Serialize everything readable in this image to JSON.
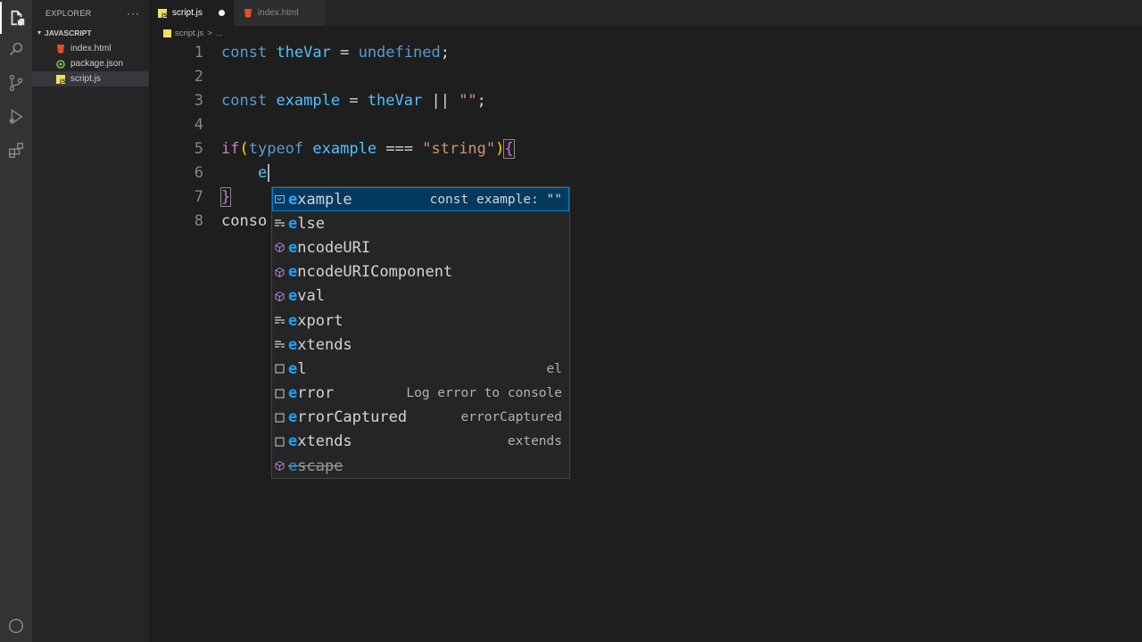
{
  "sidebar": {
    "title": "EXPLORER",
    "more": "···",
    "section": "JAVASCRIPT",
    "files": [
      {
        "name": "index.html",
        "icon": "html-file-icon",
        "color": "#e44d26"
      },
      {
        "name": "package.json",
        "icon": "npm-file-icon",
        "color": "#8bc34a"
      },
      {
        "name": "script.js",
        "icon": "js-file-icon",
        "color": "#f1e05a"
      }
    ]
  },
  "tabs": [
    {
      "label": "script.js",
      "active": true,
      "dirty": true
    },
    {
      "label": "index.html",
      "active": false
    }
  ],
  "breadcrumb": {
    "file": "script.js",
    "sep": ">",
    "rest": "..."
  },
  "editor": {
    "line_numbers": [
      "1",
      "2",
      "3",
      "4",
      "5",
      "6",
      "7",
      "8"
    ],
    "lines": {
      "l1": {
        "kw": "const",
        "var": "theVar",
        "eq": " = ",
        "val": "undefined",
        "end": ";"
      },
      "l3": {
        "kw": "const",
        "var": "example",
        "eq": " = ",
        "var2": "theVar",
        "op": " || ",
        "str": "\"\"",
        "end": ";"
      },
      "l5": {
        "kw": "if",
        "open": "(",
        "kw2": "typeof",
        "var": "example",
        "op": " === ",
        "str": "\"string\"",
        "close": ")",
        "brace": "{"
      },
      "l6": {
        "indent": "    ",
        "typed": "e"
      },
      "l7": {
        "brace": "}"
      },
      "l8": {
        "text": "conso"
      }
    }
  },
  "suggest": {
    "items": [
      {
        "hl": "e",
        "rest": "xample",
        "detail": "const example: \"\"",
        "icon": "variable-icon",
        "focused": true
      },
      {
        "hl": "e",
        "rest": "lse",
        "detail": "",
        "icon": "keyword-icon"
      },
      {
        "hl": "e",
        "rest": "ncodeURI",
        "detail": "",
        "icon": "module-icon"
      },
      {
        "hl": "e",
        "rest": "ncodeURIComponent",
        "detail": "",
        "icon": "module-icon"
      },
      {
        "hl": "e",
        "rest": "val",
        "detail": "",
        "icon": "module-icon"
      },
      {
        "hl": "e",
        "rest": "xport",
        "detail": "",
        "icon": "keyword-icon"
      },
      {
        "hl": "e",
        "rest": "xtends",
        "detail": "",
        "icon": "keyword-icon"
      },
      {
        "hl": "e",
        "rest": "l",
        "detail": "el",
        "icon": "snippet-icon"
      },
      {
        "hl": "e",
        "rest": "rror",
        "detail": "Log error to console",
        "icon": "snippet-icon"
      },
      {
        "hl": "e",
        "rest": "rrorCaptured",
        "detail": "errorCaptured",
        "icon": "snippet-icon"
      },
      {
        "hl": "e",
        "rest": "xtends",
        "detail": "extends",
        "icon": "snippet-icon"
      },
      {
        "hl": "e",
        "rest": "scape",
        "detail": "",
        "icon": "module-icon",
        "deprecated": true
      }
    ]
  }
}
